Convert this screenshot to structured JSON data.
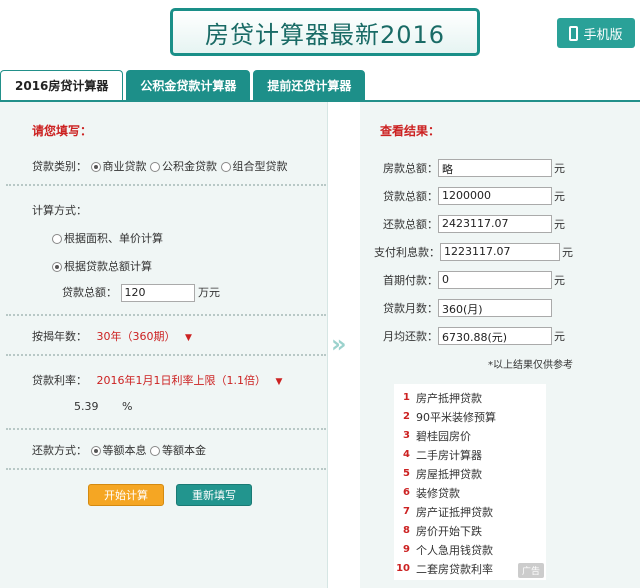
{
  "header": {
    "title": "房贷计算器最新2016",
    "mobile_label": "手机版"
  },
  "tabs": [
    {
      "label": "2016房贷计算器"
    },
    {
      "label": "公积金贷款计算器"
    },
    {
      "label": "提前还贷计算器"
    }
  ],
  "form": {
    "section_title": "请您填写：",
    "loan_type_label": "贷款类别：",
    "loan_types": [
      "商业贷款",
      "公积金贷款",
      "组合型贷款"
    ],
    "calc_method_label": "计算方式：",
    "calc_methods": [
      "根据面积、单价计算",
      "根据贷款总额计算"
    ],
    "loan_total_label": "贷款总额：",
    "loan_total_value": "120",
    "loan_total_unit": "万元",
    "years_label": "按揭年数：",
    "years_value": "30年（360期）",
    "rate_label": "贷款利率：",
    "rate_value": "2016年1月1日利率上限（1.1倍）",
    "rate_number": "5.39",
    "rate_unit": "%",
    "repay_label": "还款方式：",
    "repay_methods": [
      "等额本息",
      "等额本金"
    ],
    "start_button": "开始计算",
    "reset_button": "重新填写",
    "dropdown_icon": "▼"
  },
  "results": {
    "section_title": "查看结果：",
    "rows": [
      {
        "label": "房款总额：",
        "value": "略",
        "unit": "元"
      },
      {
        "label": "贷款总额：",
        "value": "1200000",
        "unit": "元"
      },
      {
        "label": "还款总额：",
        "value": "2423117.07",
        "unit": "元"
      },
      {
        "label": "支付利息款：",
        "value": "1223117.07",
        "unit": "元"
      },
      {
        "label": "首期付款：",
        "value": "0",
        "unit": "元"
      },
      {
        "label": "贷款月数：",
        "value": "360(月)",
        "unit": ""
      },
      {
        "label": "月均还款：",
        "value": "6730.88(元)",
        "unit": "元"
      }
    ],
    "note": "*以上结果仅供参考"
  },
  "ads": {
    "items": [
      {
        "num": "1",
        "label": "房产抵押贷款"
      },
      {
        "num": "2",
        "label": "90平米装修预算"
      },
      {
        "num": "3",
        "label": "碧桂园房价"
      },
      {
        "num": "4",
        "label": "二手房计算器"
      },
      {
        "num": "5",
        "label": "房屋抵押贷款"
      },
      {
        "num": "6",
        "label": "装修贷款"
      },
      {
        "num": "7",
        "label": "房产证抵押贷款"
      },
      {
        "num": "8",
        "label": "房价开始下跌"
      },
      {
        "num": "9",
        "label": "个人急用钱贷款"
      },
      {
        "num": "10",
        "label": "二套房贷款利率"
      }
    ],
    "badge": "广告"
  },
  "arrow_icon": "»"
}
